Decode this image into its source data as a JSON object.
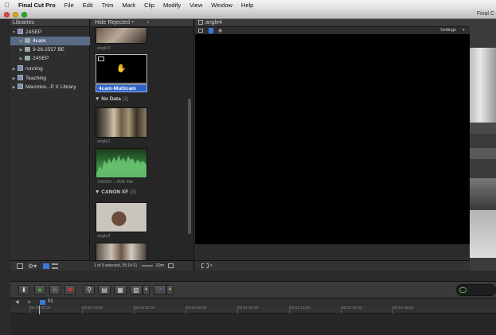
{
  "menubar": {
    "apple": "",
    "app_name": "Final Cut Pro",
    "items": [
      "File",
      "Edit",
      "Trim",
      "Mark",
      "Clip",
      "Modify",
      "View",
      "Window",
      "Help"
    ]
  },
  "window": {
    "title": "Final C"
  },
  "libraries": {
    "header": "Libraries",
    "rows": [
      {
        "label": "24SEP",
        "kind": "library",
        "expanded": true
      },
      {
        "label": "4cam",
        "kind": "event",
        "selected": true
      },
      {
        "label": "9-26-2557 BE",
        "kind": "event"
      },
      {
        "label": "24SEP",
        "kind": "event"
      },
      {
        "label": "running",
        "kind": "library"
      },
      {
        "label": "Teaching",
        "kind": "library"
      },
      {
        "label": "Macintos...P X Library",
        "kind": "library"
      }
    ]
  },
  "browser": {
    "filter": "Hide Rejected ÷",
    "clips": [
      {
        "caption": "angle3"
      },
      {
        "caption": "4cam-Multicam",
        "selected": true
      },
      {
        "caption": "angle1"
      },
      {
        "caption": "140905 ...AVE File"
      },
      {
        "caption": "angle2"
      }
    ],
    "sections": [
      {
        "name": "No Data",
        "count": "(2)"
      },
      {
        "name": "CANON XF",
        "count": "(3)"
      }
    ],
    "status": "1 of 9 selected, 35:14:11",
    "zoom": "10m"
  },
  "viewer": {
    "clip_name": "angle4",
    "settings": "Settings"
  },
  "timeline": {
    "track_label": "01",
    "ticks": [
      "00:00:00:00",
      "00:00:15:00",
      "00:00:30:00",
      "00:00:45:00",
      "00:01:00:00",
      "00:01:15:00",
      "00:01:30:00",
      "00:01:45:00"
    ]
  },
  "colors": {
    "selection": "#5b6b86",
    "accent_blue": "#3b7ad9",
    "reject_red": "#d33",
    "favorite_green": "#3c3"
  }
}
